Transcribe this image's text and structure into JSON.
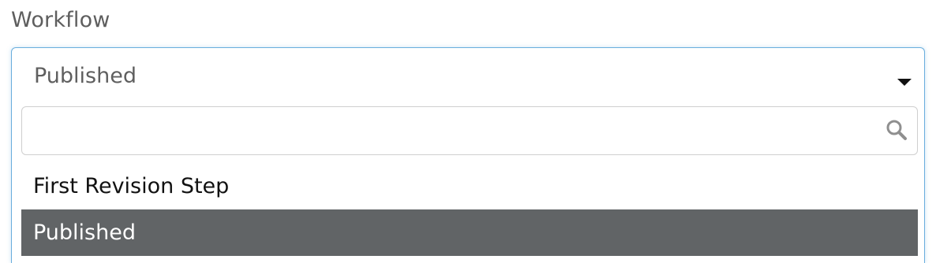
{
  "field": {
    "label": "Workflow"
  },
  "select": {
    "value": "Published",
    "search_placeholder": "",
    "options": [
      {
        "label": "First Revision Step",
        "selected": false
      },
      {
        "label": "Published",
        "selected": true
      }
    ]
  },
  "icons": {
    "caret": "chevron-down-icon",
    "search": "search-icon"
  },
  "colors": {
    "focus_border": "#6aaedd",
    "selected_bg": "#616466",
    "selected_text": "#ffffff"
  }
}
